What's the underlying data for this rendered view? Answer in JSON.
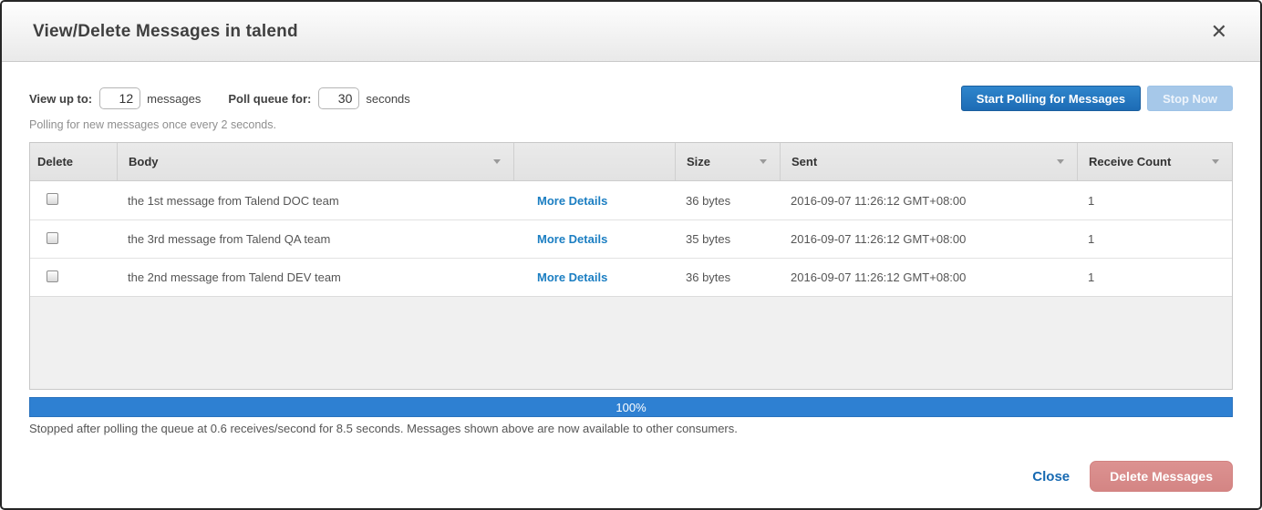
{
  "window": {
    "title": "View/Delete Messages in talend",
    "close_icon": "✕"
  },
  "controls": {
    "view_up_to_label": "View up to:",
    "view_up_to_value": "12",
    "messages_unit": "messages",
    "poll_queue_label": "Poll queue for:",
    "poll_queue_value": "30",
    "seconds_unit": "seconds",
    "start_polling_button": "Start Polling for Messages",
    "stop_now_button": "Stop Now",
    "polling_note": "Polling for new messages once every 2 seconds."
  },
  "table": {
    "headers": [
      {
        "label": "Delete",
        "sortable": false
      },
      {
        "label": "Body",
        "sortable": true
      },
      {
        "label": "",
        "sortable": false
      },
      {
        "label": "Size",
        "sortable": true
      },
      {
        "label": "Sent",
        "sortable": true
      },
      {
        "label": "Receive Count",
        "sortable": true
      }
    ],
    "rows": [
      {
        "body": "the 1st message from Talend DOC team",
        "details_link": "More Details",
        "size": "36 bytes",
        "sent": "2016-09-07 11:26:12 GMT+08:00",
        "receive_count": "1"
      },
      {
        "body": "the 3rd message from Talend QA team",
        "details_link": "More Details",
        "size": "35 bytes",
        "sent": "2016-09-07 11:26:12 GMT+08:00",
        "receive_count": "1"
      },
      {
        "body": "the 2nd message from Talend DEV team",
        "details_link": "More Details",
        "size": "36 bytes",
        "sent": "2016-09-07 11:26:12 GMT+08:00",
        "receive_count": "1"
      }
    ]
  },
  "progress": {
    "value": 100,
    "label": "100%"
  },
  "status_text": "Stopped after polling the queue at 0.6 receives/second for 8.5 seconds. Messages shown above are now available to other consumers.",
  "footer": {
    "close_label": "Close",
    "delete_button": "Delete Messages"
  },
  "colors": {
    "accent_top": "#2f86cc",
    "accent_bottom": "#1d6cb5",
    "disabled_blue": "#a6c8e9",
    "link_blue": "#1b7ec2",
    "progress_blue": "#2e80d2",
    "delete_red_top": "#dc9291",
    "delete_red_bottom": "#d48584"
  }
}
